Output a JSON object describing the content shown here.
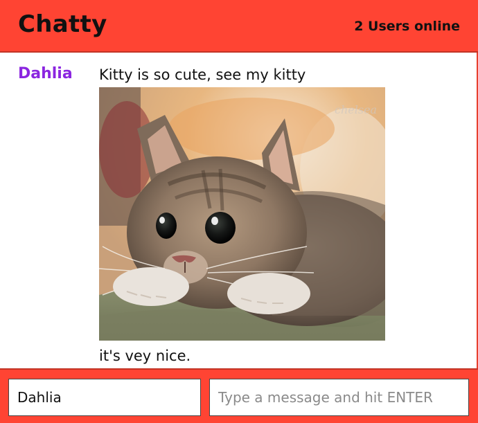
{
  "header": {
    "title": "Chatty",
    "online_count": "2 Users online"
  },
  "messages": [
    {
      "username": "Dahlia",
      "username_color": "#8b26e0",
      "text_before": "Kitty is so cute, see my kitty",
      "image": "kitten-photo",
      "text_after": "it's vey nice."
    }
  ],
  "chatbar": {
    "username_value": "Dahlia",
    "message_placeholder": "Type a message and hit ENTER"
  },
  "colors": {
    "accent": "#ff4433",
    "username": "#8b26e0"
  }
}
